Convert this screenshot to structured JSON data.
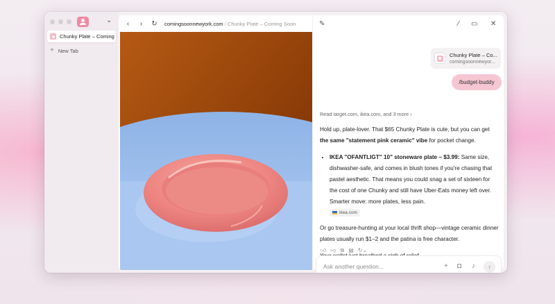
{
  "sidebar": {
    "active_tab_label": "Chunky Plate – Coming Soon",
    "new_tab_label": "New Tab"
  },
  "browser": {
    "url_host": "comingsoonnewyork.com",
    "url_sep": "/",
    "page_title": "Chunky Plate – Coming Soon"
  },
  "chat": {
    "source_card": {
      "title": "Chunky Plate – Co...",
      "domain": "comingsoonnewyor..."
    },
    "user_message": "/budget-buddy",
    "read_sources": "Read target.com, ikea.com, and 3 more",
    "reply": {
      "intro_1": "Hold up, plate-lover. That $65 Chunky Plate is cute, but you can get ",
      "intro_bold": "the same \"statement pink ceramic\" vibe",
      "intro_2": " for pocket change.",
      "bullet_bold": "IKEA \"OFANTLIGT\" 10\" stoneware plate – $3.99:",
      "bullet_text": " Same size, dishwasher-safe, and comes in blush tones if you're chasing that pastel aesthetic. That means you could snag a set of sixteen for the cost of one Chunky and still have Uber-Eats money left over. Smarter move: more plates, less pain.",
      "citation": "ikea.com",
      "para_2": "Or go treasure-hunting at your local thrift shop—vintage ceramic dinner plates usually run $1–2 and the patina is free character.",
      "para_3": "Your wallet just breathed a sigh of relief."
    },
    "composer_placeholder": "Ask another question..."
  },
  "colors": {
    "accent_pink": "#ef8aa5",
    "bubble_pink": "#f6c6d3"
  }
}
